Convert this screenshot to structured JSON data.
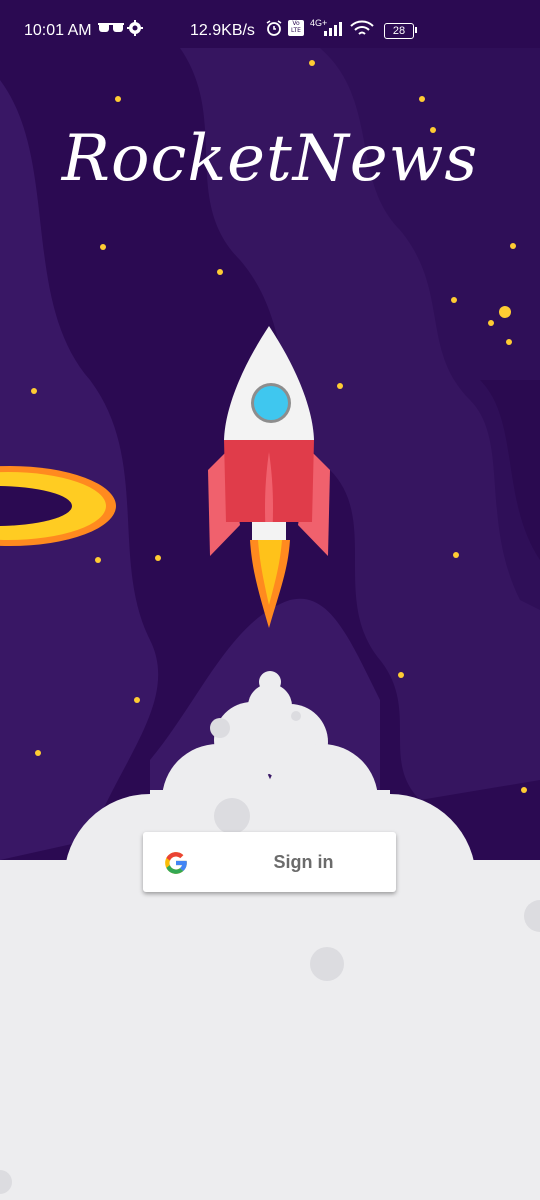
{
  "status_bar": {
    "time": "10:01 AM",
    "net_speed": "12.9KB/s",
    "volte": "Vo LTE",
    "network": "4G+",
    "battery": "28",
    "icons": [
      "sunglasses-icon",
      "gear-icon",
      "alarm-icon",
      "volte-icon",
      "signal-icon",
      "wifi-icon",
      "battery-icon"
    ]
  },
  "app": {
    "title": "RocketNews"
  },
  "signin": {
    "label": "Sign in",
    "icon": "google-icon"
  },
  "colors": {
    "background": "#2b0a52",
    "nebula": "#3a1764",
    "star": "#ffcc33",
    "rocket_red": "#e03c4a",
    "rocket_white": "#f3f3f3",
    "window_blue": "#3fc7ef",
    "flame": "#ffb300",
    "planet_ring": "#ffcc22",
    "cloud": "#ededef"
  }
}
